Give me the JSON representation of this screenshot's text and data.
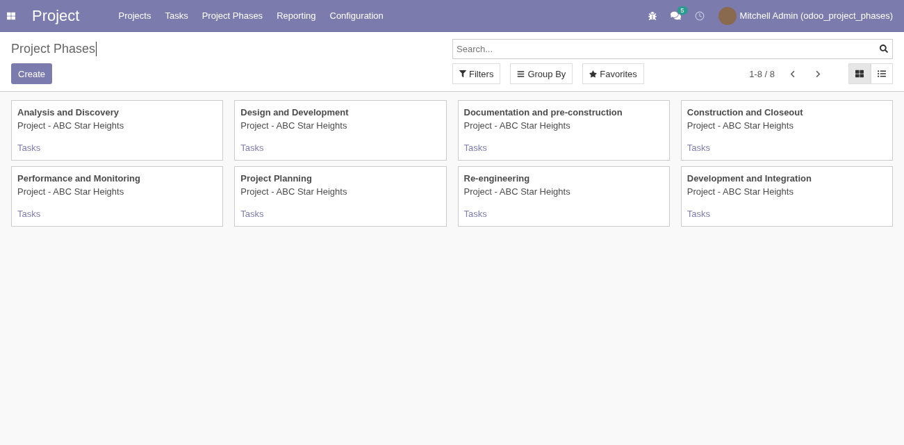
{
  "navbar": {
    "app_title": "Project",
    "menu": [
      "Projects",
      "Tasks",
      "Project Phases",
      "Reporting",
      "Configuration"
    ],
    "messages_badge": "5",
    "user": "Mitchell Admin (odoo_project_phases)"
  },
  "control_panel": {
    "breadcrumb": "Project Phases",
    "create_button": "Create",
    "search": {
      "placeholder": "Search..."
    },
    "filters": [
      "Filters",
      "Group By",
      "Favorites"
    ],
    "pager": "1-8 / 8",
    "views": [
      {
        "kind": "kanban",
        "selected": true
      },
      {
        "kind": "list",
        "selected": false
      }
    ]
  },
  "cards": [
    {
      "title": "Analysis and Discovery",
      "project": "Project - ABC Star Heights",
      "link": "Tasks"
    },
    {
      "title": "Design and Development",
      "project": "Project - ABC Star Heights",
      "link": "Tasks"
    },
    {
      "title": "Documentation and pre-construction",
      "project": "Project - ABC Star Heights",
      "link": "Tasks"
    },
    {
      "title": "Construction and Closeout",
      "project": "Project - ABC Star Heights",
      "link": "Tasks"
    },
    {
      "title": "Performance and Monitoring",
      "project": "Project - ABC Star Heights",
      "link": "Tasks"
    },
    {
      "title": "Project Planning",
      "project": "Project - ABC Star Heights",
      "link": "Tasks"
    },
    {
      "title": "Re-engineering",
      "project": "Project - ABC Star Heights",
      "link": "Tasks"
    },
    {
      "title": "Development and Integration",
      "project": "Project - ABC Star Heights",
      "link": "Tasks"
    }
  ]
}
